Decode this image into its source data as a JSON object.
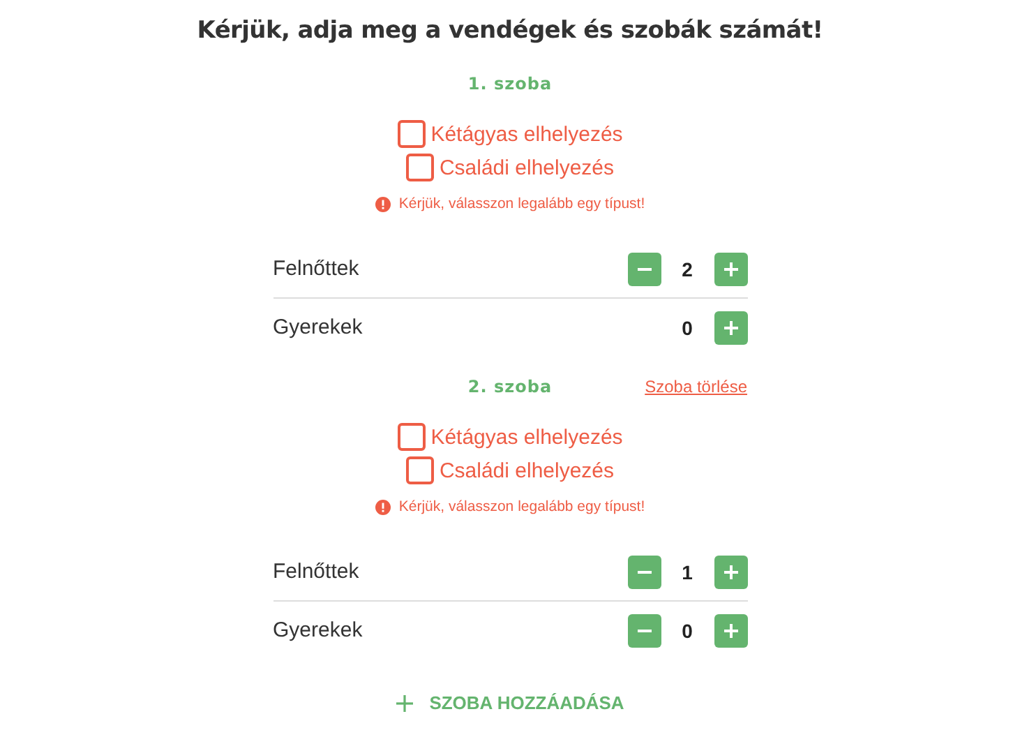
{
  "title": "Kérjük, adja meg a vendégek és szobák számát!",
  "rooms": [
    {
      "label": "1. szoba",
      "options": [
        {
          "label": "Kétágyas elhelyezés",
          "checked": false
        },
        {
          "label": "Családi elhelyezés",
          "checked": false
        }
      ],
      "error": "Kérjük, válasszon legalább egy típust!",
      "counters": [
        {
          "label": "Felnőttek",
          "value": "2",
          "decrement_shown": true
        },
        {
          "label": "Gyerekek",
          "value": "0",
          "decrement_shown": false
        }
      ]
    },
    {
      "label": "2. szoba",
      "delete_link": "Szoba törlése",
      "options": [
        {
          "label": "Kétágyas elhelyezés",
          "checked": false
        },
        {
          "label": "Családi elhelyezés",
          "checked": false
        }
      ],
      "error": "Kérjük, válasszon legalább egy típust!",
      "counters": [
        {
          "label": "Felnőttek",
          "value": "1",
          "decrement_shown": true
        },
        {
          "label": "Gyerekek",
          "value": "0",
          "decrement_shown": true
        }
      ]
    }
  ],
  "add_room_button": "SZOBA HOZZÁADÁSA"
}
